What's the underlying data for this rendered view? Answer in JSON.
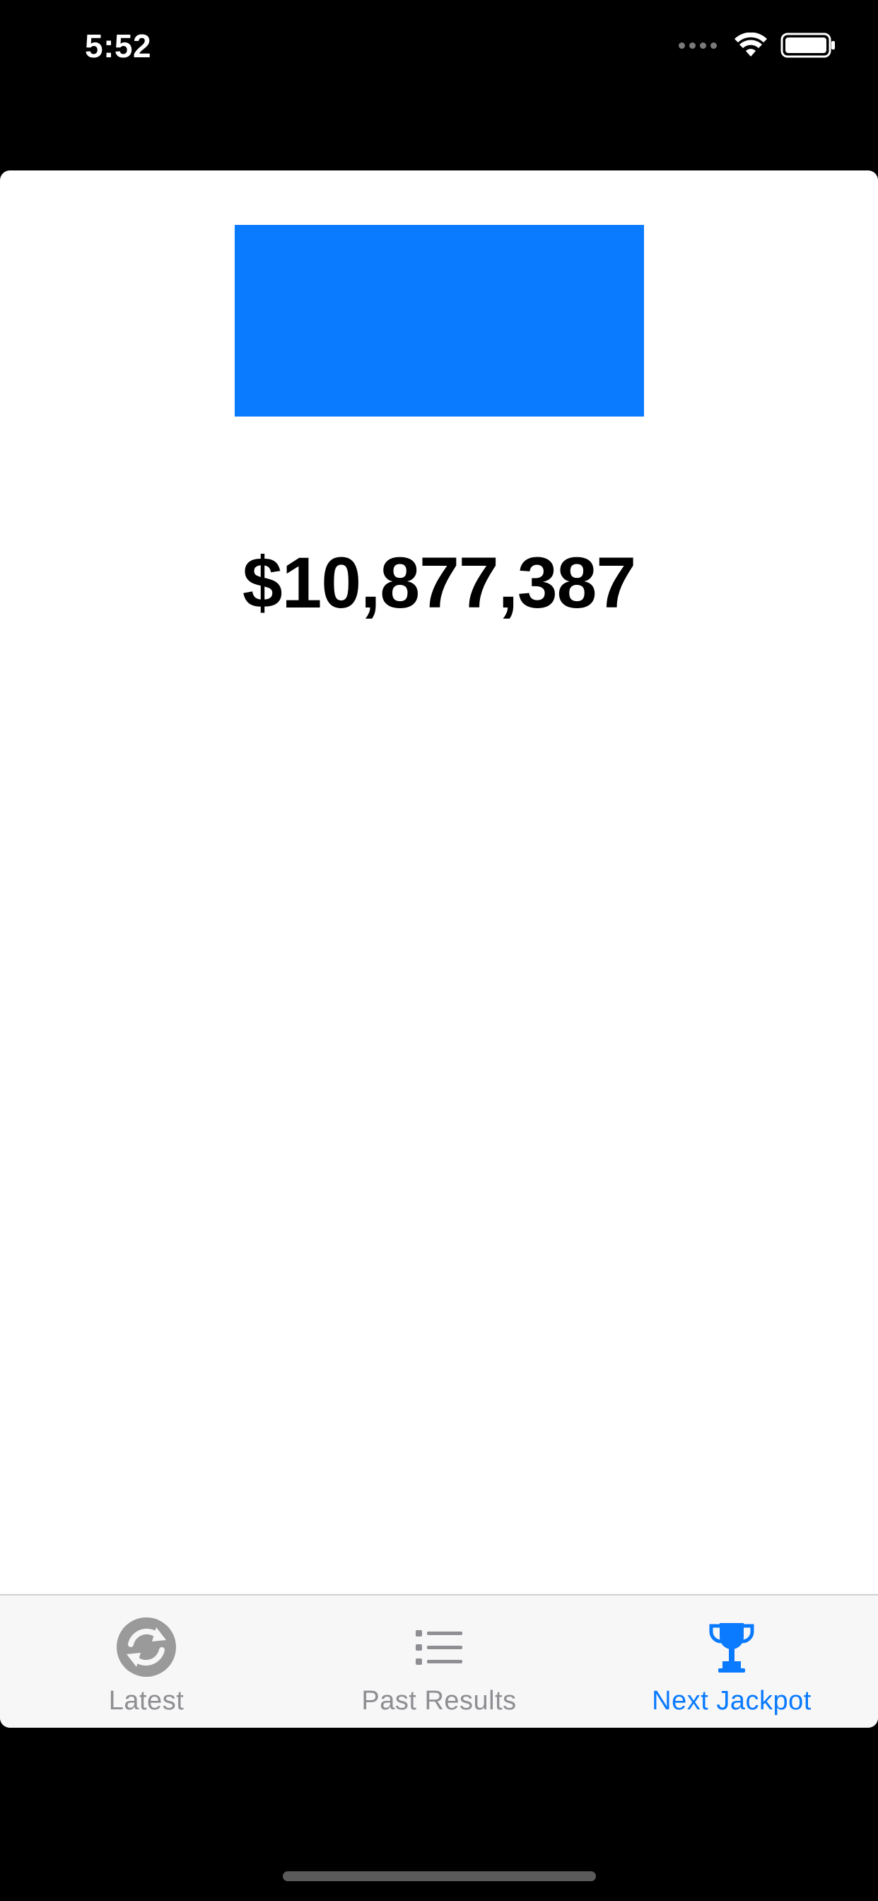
{
  "status_bar": {
    "time": "5:52",
    "icons": [
      "signal-icon",
      "wifi-icon",
      "battery-icon"
    ]
  },
  "main": {
    "ad_banner_color": "#0a7aff",
    "jackpot_amount": "$10,877,387"
  },
  "tab_bar": {
    "active_color": "#0a7aff",
    "inactive_color": "#8e8e93",
    "tabs": [
      {
        "label": "Latest",
        "icon": "refresh-icon",
        "active": false
      },
      {
        "label": "Past Results",
        "icon": "list-icon",
        "active": false
      },
      {
        "label": "Next Jackpot",
        "icon": "trophy-icon",
        "active": true
      }
    ]
  }
}
